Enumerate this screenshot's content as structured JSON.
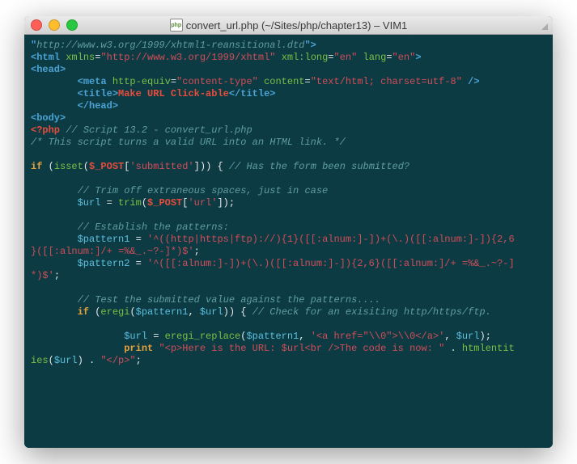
{
  "window": {
    "title": "convert_url.php (~/Sites/php/chapter13) – VIM1",
    "file_badge": "php"
  },
  "code": {
    "l1_doctype": "http://www.w3.org/1999/xhtml1-reansitional.dtd",
    "l2_tag": "html",
    "l2_attr1": "xmlns",
    "l2_val1": "http://www.w3.org/1999/xhtml",
    "l2_attr2": "xml:long",
    "l2_val2": "en",
    "l2_attr3": "lang",
    "l2_val3": "en",
    "l3_head": "head",
    "l4_meta": "meta",
    "l4_a1": "http-equiv",
    "l4_v1": "content-type",
    "l4_a2": "content",
    "l4_v2": "text/html; charset=utf-8",
    "l5_title": "title",
    "l5_text": "Make URL Click-able",
    "l7_body": "body",
    "l8_php": "<?php",
    "l8_com": " // Script 13.2 - convert_url.php",
    "l9_com": "/* This script turns a valid URL into an HTML link. */",
    "l11_if": "if",
    "l11_isset": "isset",
    "l11_post": "$_POST",
    "l11_key": "'submitted'",
    "l11_com": " // Has the form been submitted?",
    "l13_com": "// Trim off extraneous spaces, just in case",
    "l14_url": "$url",
    "l14_trim": "trim",
    "l14_post": "$_POST",
    "l14_key": "'url'",
    "l16_com": "// Establish the patterns:",
    "l17_p1": "$pattern1",
    "l17_val": "'^((http|https|ftp)://){1}([[:alnum:]-])+(\\.)([[:alnum:]-]){2,6}([[:alnum:]/+ =%&_.~?-]*)$'",
    "l18_p2": "$pattern2",
    "l18_val": "'^([[:alnum:]-])+(\\.)([[:alnum:]-]){2,6}([[:alnum:]/+ =%&_.~?-]*)$'",
    "l20_com": "// Test the submitted value against the patterns....",
    "l21_if": "if",
    "l21_eregi": "eregi",
    "l21_a1": "$pattern1",
    "l21_a2": "$url",
    "l21_com": " // Check for an exisiting http/https/ftp.",
    "l23_url": "$url",
    "l23_fn": "eregi_replace",
    "l23_a1": "$pattern1",
    "l23_a2": "'<a href=\"\\\\0\">\\\\0</a>'",
    "l23_a3": "$url",
    "l24_print": "print",
    "l24_s1": "\"<p>Here is the URL: $url<br />The code is now: \"",
    "l24_fn": "htmlentities",
    "l24_a": "$url",
    "l24_s2": "\"</p>\""
  }
}
